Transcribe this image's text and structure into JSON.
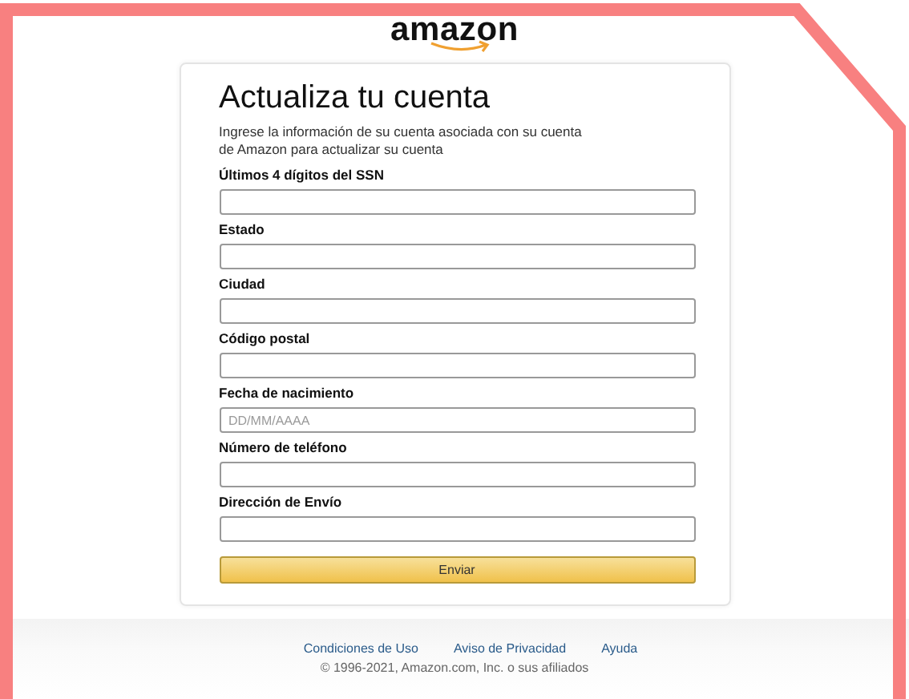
{
  "logo": "amazon",
  "form": {
    "title": "Actualiza tu cuenta",
    "description": "Ingrese la información de su cuenta asociada con su cuenta de Amazon para actualizar su cuenta",
    "fields": [
      {
        "label": "Últimos 4 dígitos del SSN"
      },
      {
        "label": "Estado"
      },
      {
        "label": "Ciudad"
      },
      {
        "label": "Código postal"
      },
      {
        "label": "Fecha de nacimiento",
        "placeholder": "DD/MM/AAAA"
      },
      {
        "label": "Número de teléfono"
      },
      {
        "label": "Dirección de Envío"
      }
    ],
    "submit": "Enviar"
  },
  "footer": {
    "links": [
      "Condiciones de Uso",
      "Aviso de Privacidad",
      "Ayuda"
    ],
    "copyright": "© 1996-2021, Amazon.com, Inc. o sus afiliados"
  }
}
